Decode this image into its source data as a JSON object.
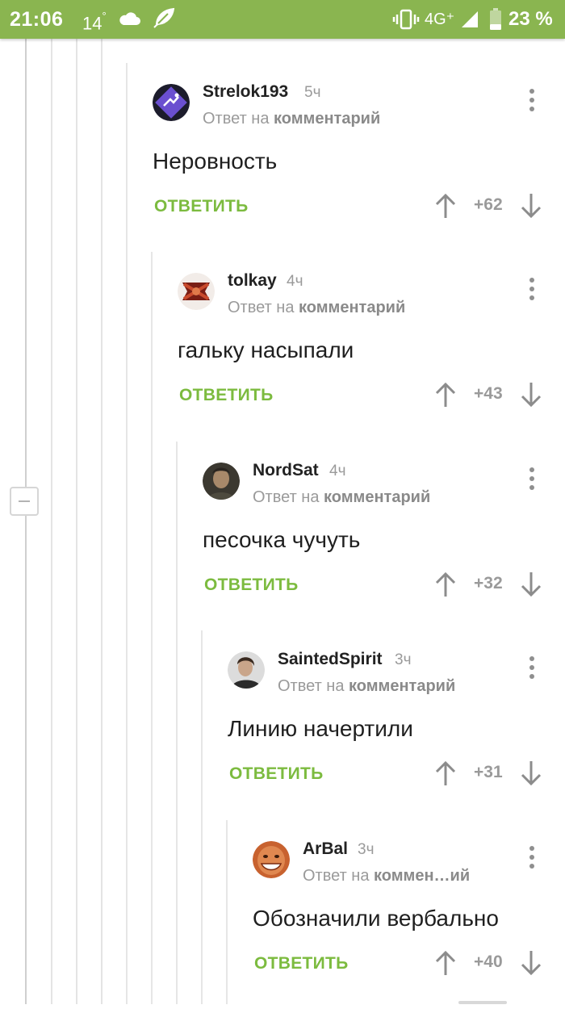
{
  "status_bar": {
    "time": "21:06",
    "temperature": "14",
    "degree_symbol": "°",
    "network": "4G⁺",
    "battery_percent": "23 %",
    "background_color": "#8ab550",
    "icons": [
      "cloud-icon",
      "feather-icon",
      "vibrate-icon",
      "signal-icon",
      "battery-icon"
    ]
  },
  "colors": {
    "accent_green": "#7cbb3f",
    "muted": "#9a9a9a"
  },
  "reply_label": "ОТВЕТИТЬ",
  "reply_prefix": "Ответ на",
  "comments": [
    {
      "author": "Strelok193",
      "time": "5ч",
      "reply_to": "комментарий",
      "text": "Неровность",
      "score": "+62",
      "avatar_icon": "bat-logo-avatar"
    },
    {
      "author": "tolkay",
      "time": "4ч",
      "reply_to": "комментарий",
      "text": "гальку насыпали",
      "score": "+43",
      "avatar_icon": "red-emblem-avatar"
    },
    {
      "author": "NordSat",
      "time": "4ч",
      "reply_to": "комментарий",
      "text": "песочка чучуть",
      "score": "+32",
      "avatar_icon": "portrait-avatar"
    },
    {
      "author": "SaintedSpirit",
      "time": "3ч",
      "reply_to": "комментарий",
      "text": "Линию начертили",
      "score": "+31",
      "avatar_icon": "portrait-avatar"
    },
    {
      "author": "ArBal",
      "time": "3ч",
      "reply_to": "коммен…ий",
      "text": "Обозначили вербально",
      "score": "+40",
      "avatar_icon": "face-avatar"
    }
  ]
}
